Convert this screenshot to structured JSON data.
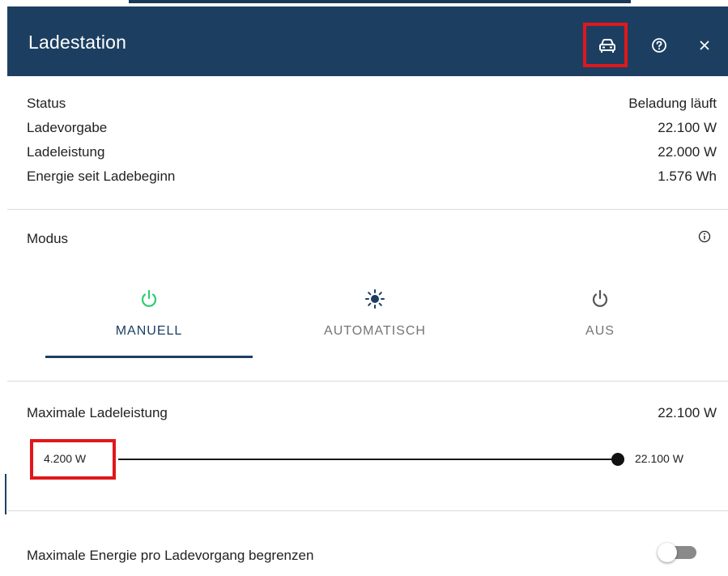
{
  "header": {
    "title": "Ladestation",
    "background": "#1c3f61",
    "icons": {
      "car": "car-icon",
      "help": "help-circle-icon",
      "close": "close-icon"
    },
    "close_glyph": "×"
  },
  "status": {
    "rows": [
      {
        "label": "Status",
        "value": "Beladung läuft"
      },
      {
        "label": "Ladevorgabe",
        "value": "22.100 W"
      },
      {
        "label": "Ladeleistung",
        "value": "22.000 W"
      },
      {
        "label": "Energie seit Ladebeginn",
        "value": "1.576 Wh"
      }
    ]
  },
  "mode": {
    "title": "Modus",
    "selected": "MANUELL",
    "tabs": [
      {
        "label": "MANUELL",
        "icon": "power-icon",
        "color": "#2ecc71"
      },
      {
        "label": "AUTOMATISCH",
        "icon": "sun-icon",
        "color": "#1c3f61"
      },
      {
        "label": "AUS",
        "icon": "power-icon",
        "color": "#555555"
      }
    ]
  },
  "max_power": {
    "label": "Maximale Ladeleistung",
    "value": "22.100 W",
    "min_label": "4.200 W",
    "max_label": "22.100 W",
    "slider_fraction": 1.0
  },
  "energy_limit": {
    "label": "Maximale Energie pro Ladevorgang begrenzen",
    "enabled": false
  },
  "accent": "#1c3f61",
  "highlight_color": "#e0181b"
}
